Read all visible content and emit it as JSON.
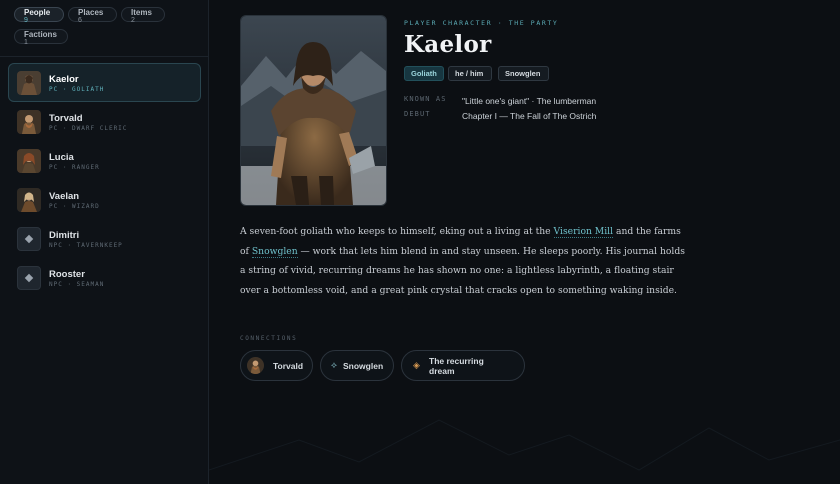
{
  "filters": [
    {
      "label": "People",
      "count": "9",
      "active": true
    },
    {
      "label": "Places",
      "count": "6",
      "active": false
    },
    {
      "label": "Items",
      "count": "2",
      "active": false
    },
    {
      "label": "Factions",
      "count": "1",
      "active": false
    }
  ],
  "people": [
    {
      "name": "Kaelor",
      "sub": "PC · GOLIATH",
      "thumb": "portrait",
      "active": true
    },
    {
      "name": "Torvald",
      "sub": "PC · DWARF CLERIC",
      "thumb": "portrait",
      "active": false
    },
    {
      "name": "Lucia",
      "sub": "PC · RANGER",
      "thumb": "portrait",
      "active": false
    },
    {
      "name": "Vaelan",
      "sub": "PC · WIZARD",
      "thumb": "portrait",
      "active": false
    },
    {
      "name": "Dimitri",
      "sub": "NPC · TAVERNKEEP",
      "thumb": "diamond-icon",
      "active": false
    },
    {
      "name": "Rooster",
      "sub": "NPC · SEAMAN",
      "thumb": "diamond-icon",
      "active": false
    }
  ],
  "detail": {
    "kicker": "PLAYER CHARACTER · THE PARTY",
    "title": "Kaelor",
    "tags": [
      "Goliath",
      "he / him",
      "Snowglen"
    ],
    "meta": {
      "known_as_label": "KNOWN AS",
      "known_as": "\"Little one's giant\" · The lumberman",
      "debut_label": "DEBUT",
      "debut": "Chapter I — The Fall of The Ostrich"
    },
    "description": {
      "p1": "A seven-foot goliath who keeps to himself, eking out a living at the ",
      "link1": "Viserion Mill",
      "p2": " and the farms of ",
      "link2": "Snowglen",
      "p3": " — work that lets him blend in and stay unseen. He sleeps poorly. His journal holds a string of vivid, recurring dreams he has shown no one: a lightless labyrinth, a floating stair over a bottomless void, and a great pink crystal that cracks open to something waking inside."
    },
    "connections_label": "CONNECTIONS",
    "connections": [
      {
        "label": "Torvald",
        "icon": "portrait"
      },
      {
        "label": "Snowglen",
        "icon": "place-icon"
      },
      {
        "label": "The recurring dream",
        "icon": "diamond-icon"
      }
    ]
  },
  "colors": {
    "accent": "#5aa9b3",
    "background": "#0c0f13",
    "dream_accent": "#d79a52"
  }
}
